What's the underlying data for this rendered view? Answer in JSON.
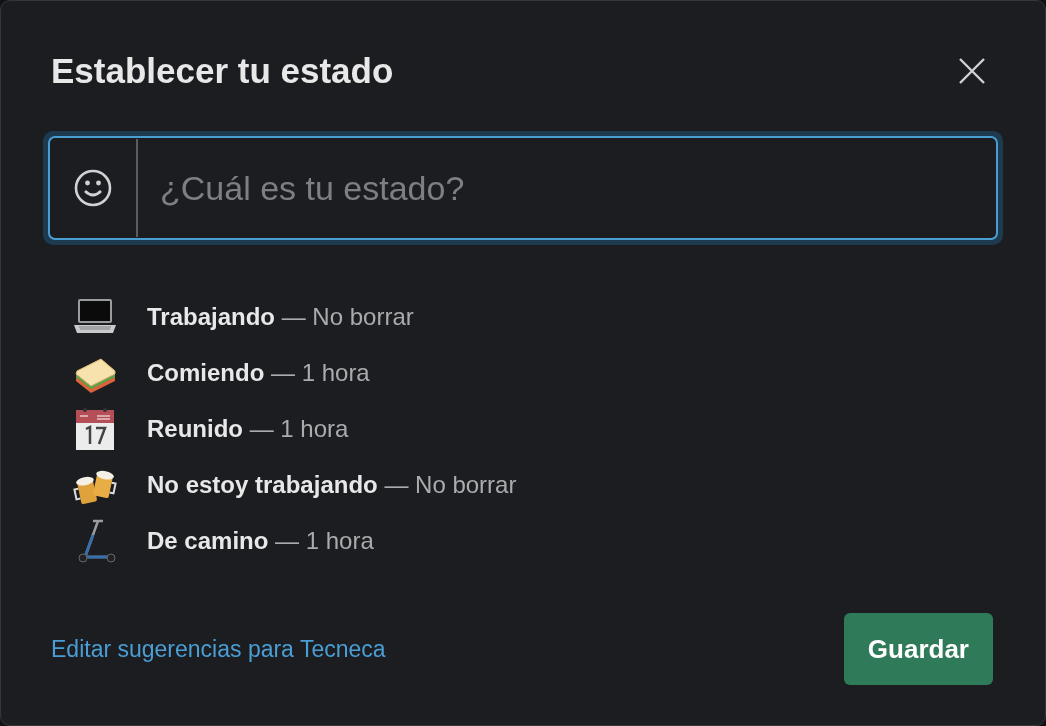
{
  "dialog": {
    "title": "Establecer tu estado"
  },
  "status_field": {
    "placeholder": "¿Cuál es tu estado?"
  },
  "suggestions": [
    {
      "text": "**Trabajando** — No borrar"
    },
    {
      "text": "**Comiendo** — 1 hora"
    },
    {
      "text": "**Reunido** — 1 hora"
    },
    {
      "text": "**No estoy trabajando** — No borrar"
    },
    {
      "text": "**De camino** — 1 hora"
    }
  ],
  "footer": {
    "link": "Editar sugerencias para Tecneca",
    "button": "Guardar"
  }
}
